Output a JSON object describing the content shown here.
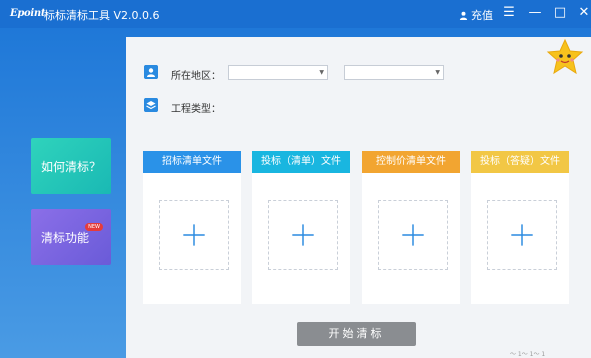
{
  "titlebar": {
    "logo": "Epoint",
    "title": "标标清标工具 V2.0.0.6",
    "recharge": "充值",
    "controls": [
      "menu-icon",
      "minimize-icon",
      "maximize-icon",
      "close-icon"
    ]
  },
  "sidebar": {
    "items": [
      {
        "label": "如何清标？",
        "color": "#22c7b8"
      },
      {
        "label": "清标功能",
        "badge": "NEW",
        "color": "#7a64e0"
      }
    ]
  },
  "form": {
    "region_label": "所在地区：",
    "region_select_1": "",
    "region_select_2": "",
    "project_type_label": "工程类型："
  },
  "upload_columns": [
    {
      "title": "招标清单文件",
      "color": "#2a92e8"
    },
    {
      "title": "投标（清单）文件",
      "color": "#19b6e0"
    },
    {
      "title": "控制价清单文件",
      "color": "#f2a531"
    },
    {
      "title": "投标（答疑）文件",
      "color": "#f2c745"
    }
  ],
  "actions": {
    "start_label": "开始清标"
  },
  "watermark": "～ 1～ 1～ 1"
}
